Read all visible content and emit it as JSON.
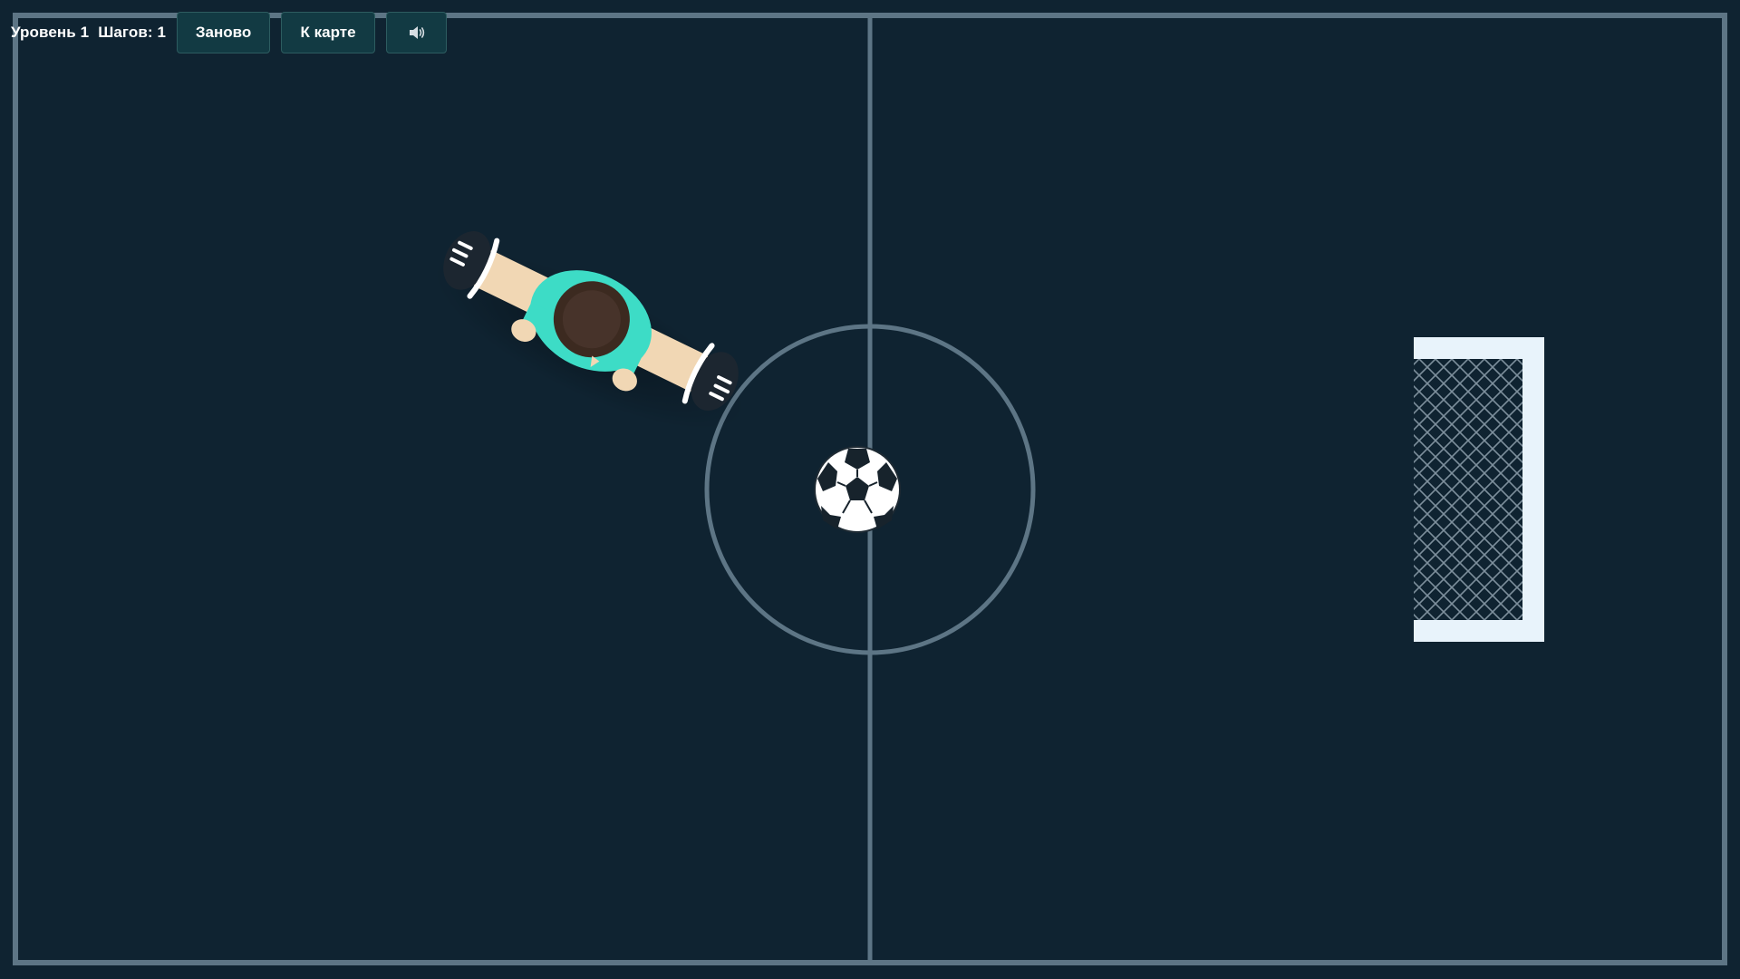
{
  "hud": {
    "level_label": "Уровень 1",
    "steps_label": "Шагов: 1",
    "restart_label": "Заново",
    "map_label": "К карте",
    "sound_icon": "speaker-icon"
  },
  "colors": {
    "pitch": "#0f2331",
    "lines": "#5d7585",
    "jersey": "#3ddcc6",
    "skin": "#f1d7b4",
    "hair": "#3c2a20",
    "goal": "#e8f3fb",
    "net": "#7d8f9c"
  }
}
